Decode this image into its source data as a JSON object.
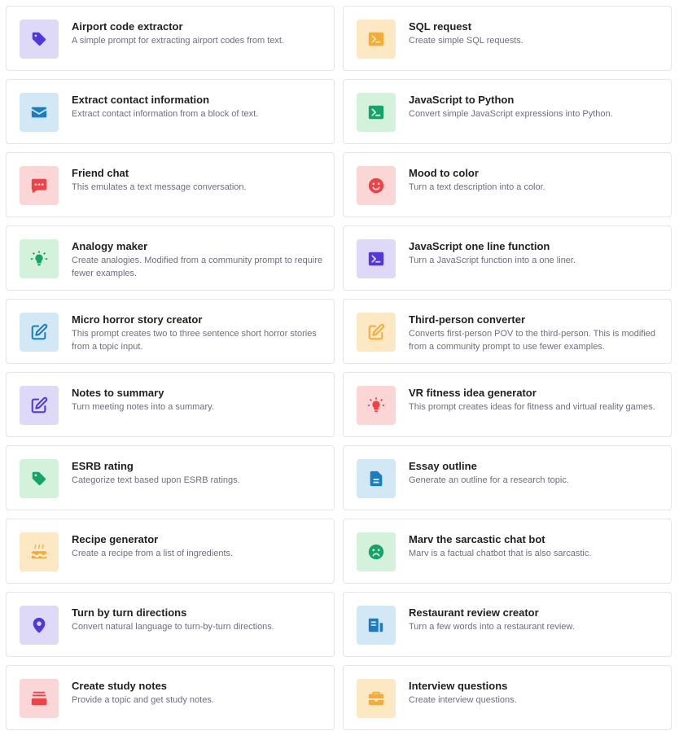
{
  "examples": [
    {
      "title": "Airport code extractor",
      "desc": "A simple prompt for extracting airport codes from text.",
      "icon": "tag-icon",
      "color": "purple"
    },
    {
      "title": "SQL request",
      "desc": "Create simple SQL requests.",
      "icon": "terminal-icon",
      "color": "yellow"
    },
    {
      "title": "Extract contact information",
      "desc": "Extract contact information from a block of text.",
      "icon": "mail-icon",
      "color": "blue"
    },
    {
      "title": "JavaScript to Python",
      "desc": "Convert simple JavaScript expressions into Python.",
      "icon": "terminal-icon",
      "color": "green"
    },
    {
      "title": "Friend chat",
      "desc": "This emulates a text message conversation.",
      "icon": "chat-icon",
      "color": "red"
    },
    {
      "title": "Mood to color",
      "desc": "Turn a text description into a color.",
      "icon": "smile-icon",
      "color": "red"
    },
    {
      "title": "Analogy maker",
      "desc": "Create analogies. Modified from a community prompt to require fewer examples.",
      "icon": "lightbulb-icon",
      "color": "green"
    },
    {
      "title": "JavaScript one line function",
      "desc": "Turn a JavaScript function into a one liner.",
      "icon": "terminal-icon",
      "color": "purple"
    },
    {
      "title": "Micro horror story creator",
      "desc": "This prompt creates two to three sentence short horror stories from a topic input.",
      "icon": "edit-icon",
      "color": "blue"
    },
    {
      "title": "Third-person converter",
      "desc": "Converts first-person POV to the third-person. This is modified from a community prompt to use fewer examples.",
      "icon": "edit-icon",
      "color": "yellow"
    },
    {
      "title": "Notes to summary",
      "desc": "Turn meeting notes into a summary.",
      "icon": "edit-icon",
      "color": "purple"
    },
    {
      "title": "VR fitness idea generator",
      "desc": "This prompt creates ideas for fitness and virtual reality games.",
      "icon": "lightbulb-icon",
      "color": "red"
    },
    {
      "title": "ESRB rating",
      "desc": "Categorize text based upon ESRB ratings.",
      "icon": "tag-icon",
      "color": "green"
    },
    {
      "title": "Essay outline",
      "desc": "Generate an outline for a research topic.",
      "icon": "document-icon",
      "color": "blue"
    },
    {
      "title": "Recipe generator",
      "desc": "Create a recipe from a list of ingredients.",
      "icon": "cake-icon",
      "color": "yellow"
    },
    {
      "title": "Marv the sarcastic chat bot",
      "desc": "Marv is a factual chatbot that is also sarcastic.",
      "icon": "frown-icon",
      "color": "green"
    },
    {
      "title": "Turn by turn directions",
      "desc": "Convert natural language to turn-by-turn directions.",
      "icon": "map-pin-icon",
      "color": "purple"
    },
    {
      "title": "Restaurant review creator",
      "desc": "Turn a few words into a restaurant review.",
      "icon": "review-icon",
      "color": "blue"
    },
    {
      "title": "Create study notes",
      "desc": "Provide a topic and get study notes.",
      "icon": "stack-icon",
      "color": "red"
    },
    {
      "title": "Interview questions",
      "desc": "Create interview questions.",
      "icon": "briefcase-icon",
      "color": "yellow"
    }
  ]
}
